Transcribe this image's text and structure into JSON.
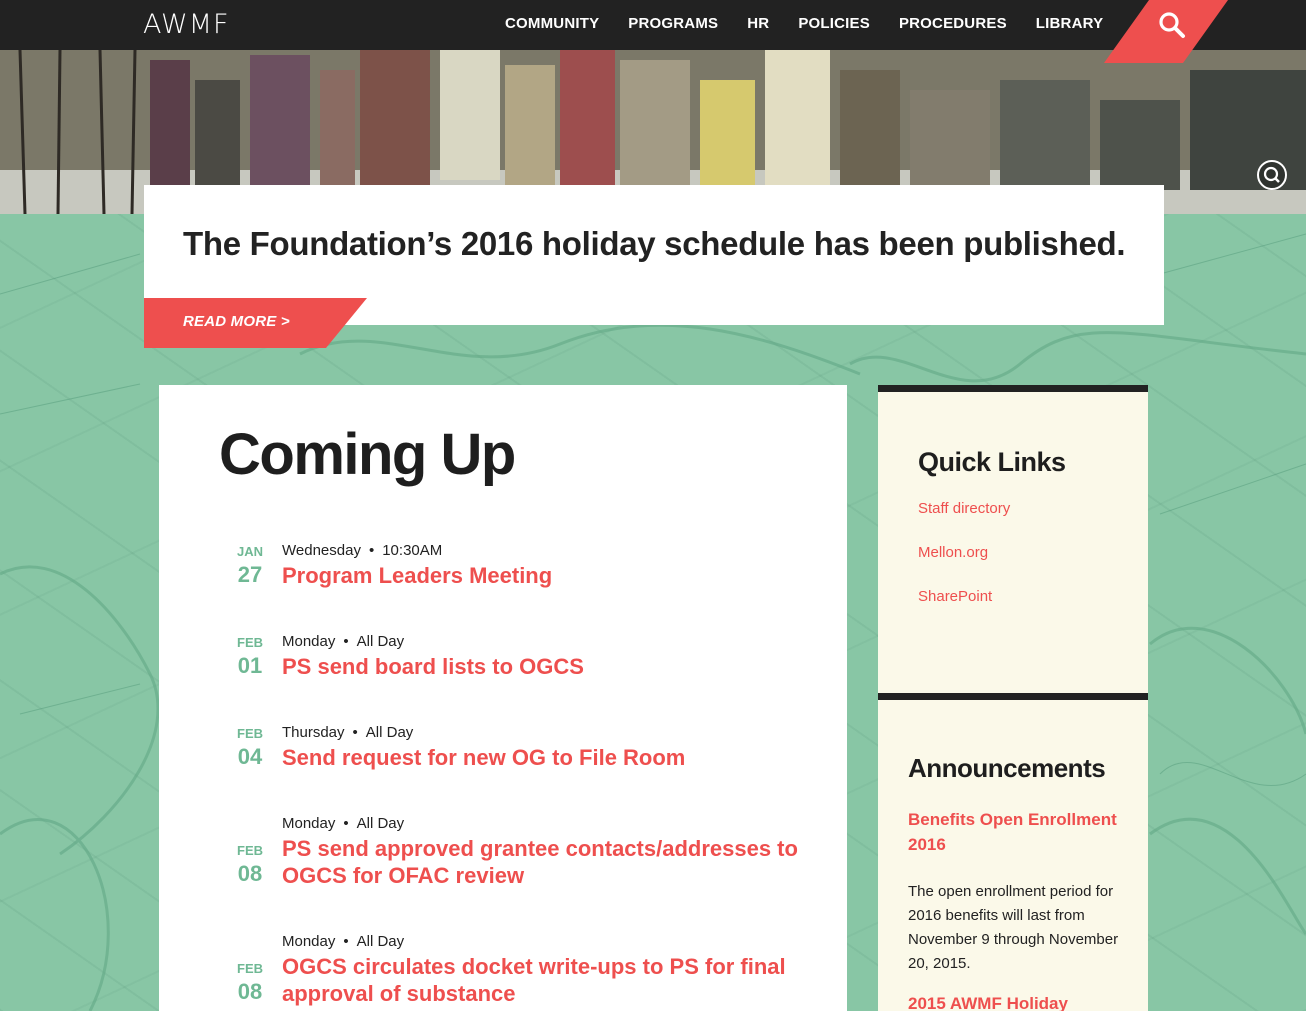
{
  "header": {
    "logo": "AWMF",
    "nav": [
      "COMMUNITY",
      "PROGRAMS",
      "HR",
      "POLICIES",
      "PROCEDURES",
      "LIBRARY"
    ]
  },
  "headline": {
    "text": "The Foundation’s 2016 holiday schedule has been published.",
    "read_more": "READ MORE >"
  },
  "coming_up": {
    "title": "Coming Up",
    "events": [
      {
        "month": "JAN",
        "day": "27",
        "weekday": "Wednesday",
        "time": "10:30AM",
        "title": "Program Leaders Meeting"
      },
      {
        "month": "FEB",
        "day": "01",
        "weekday": "Monday",
        "time": "All Day",
        "title": "PS send board lists to OGCS"
      },
      {
        "month": "FEB",
        "day": "04",
        "weekday": "Thursday",
        "time": "All Day",
        "title": "Send request for new OG to File Room"
      },
      {
        "month": "FEB",
        "day": "08",
        "weekday": "Monday",
        "time": "All Day",
        "title": "PS send approved grantee contacts/addresses to OGCS for OFAC review"
      },
      {
        "month": "FEB",
        "day": "08",
        "weekday": "Monday",
        "time": "All Day",
        "title": "OGCS circulates docket write-ups to PS for final approval of substance"
      }
    ]
  },
  "quick_links": {
    "title": "Quick Links",
    "links": [
      "Staff directory",
      "Mellon.org",
      "SharePoint"
    ]
  },
  "announcements": {
    "title": "Announcements",
    "items": [
      {
        "title": "Benefits Open Enrollment 2016",
        "body": "The open enrollment period for 2016 benefits will last from November 9 through November 20, 2015."
      },
      {
        "title": "2015 AWMF Holiday"
      }
    ]
  },
  "colors": {
    "accent": "#ee4f4e",
    "green": "#88c6a5",
    "dark": "#222222",
    "cream": "#fbf9e9"
  }
}
